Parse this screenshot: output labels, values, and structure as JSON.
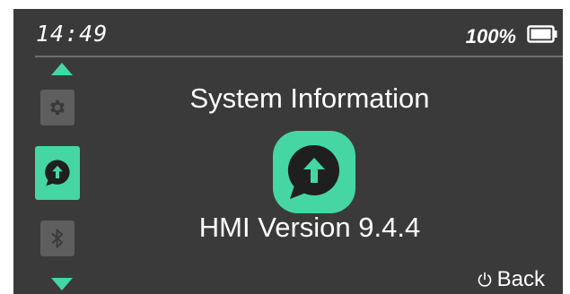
{
  "status": {
    "time": "14:49",
    "battery_percent_label": "100%",
    "battery_level": 1.0,
    "battery_icon": "battery-full-icon"
  },
  "sidebar": {
    "scroll_up_icon": "chevron-up-icon",
    "scroll_down_icon": "chevron-down-icon",
    "items": [
      {
        "icon": "gear-icon",
        "selected": false
      },
      {
        "icon": "update-icon",
        "selected": true
      },
      {
        "icon": "bluetooth-icon",
        "selected": false
      }
    ]
  },
  "main": {
    "title": "System Information",
    "icon": "update-icon",
    "version_text": "HMI Version 9.4.4"
  },
  "footer": {
    "back_label": "Back",
    "back_icon": "power-icon"
  },
  "colors": {
    "background": "#3a3a3a",
    "accent": "#45d6a4",
    "tile_inactive": "#5e5e5e",
    "text": "#ffffff"
  }
}
